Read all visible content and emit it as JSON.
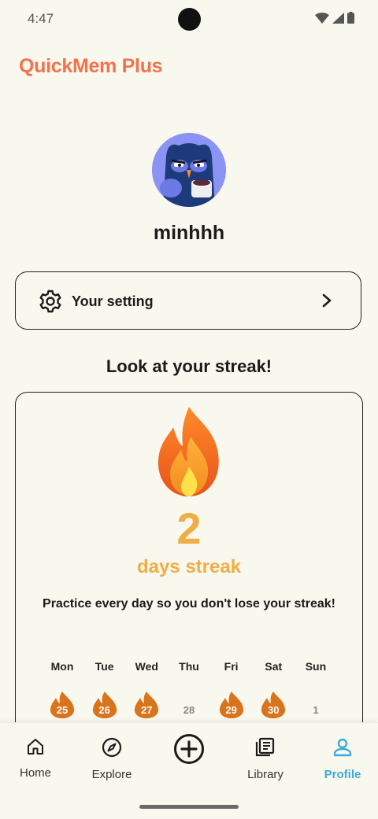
{
  "status_bar": {
    "time": "4:47"
  },
  "app": {
    "title": "QuickMem Plus"
  },
  "profile": {
    "username": "minhhh"
  },
  "settings_row": {
    "label": "Your setting"
  },
  "streak": {
    "section_title": "Look at your streak!",
    "count": "2",
    "unit_label": "days streak",
    "hint": "Practice every day so you don't lose your streak!",
    "week": [
      {
        "day": "Mon",
        "date": "25",
        "active": true
      },
      {
        "day": "Tue",
        "date": "26",
        "active": true
      },
      {
        "day": "Wed",
        "date": "27",
        "active": true
      },
      {
        "day": "Thu",
        "date": "28",
        "active": false
      },
      {
        "day": "Fri",
        "date": "29",
        "active": true
      },
      {
        "day": "Sat",
        "date": "30",
        "active": true
      },
      {
        "day": "Sun",
        "date": "1",
        "active": false
      }
    ]
  },
  "nav": {
    "items": [
      {
        "label": "Home",
        "icon": "home-icon"
      },
      {
        "label": "Explore",
        "icon": "compass-icon"
      },
      {
        "label": "",
        "icon": "add-circle-icon"
      },
      {
        "label": "Library",
        "icon": "library-icon"
      },
      {
        "label": "Profile",
        "icon": "person-icon",
        "active": true
      }
    ]
  },
  "colors": {
    "accent_title": "#f2734b",
    "streak": "#f0ae47",
    "nav_active": "#3bacd6",
    "background": "#f9f8ef"
  }
}
